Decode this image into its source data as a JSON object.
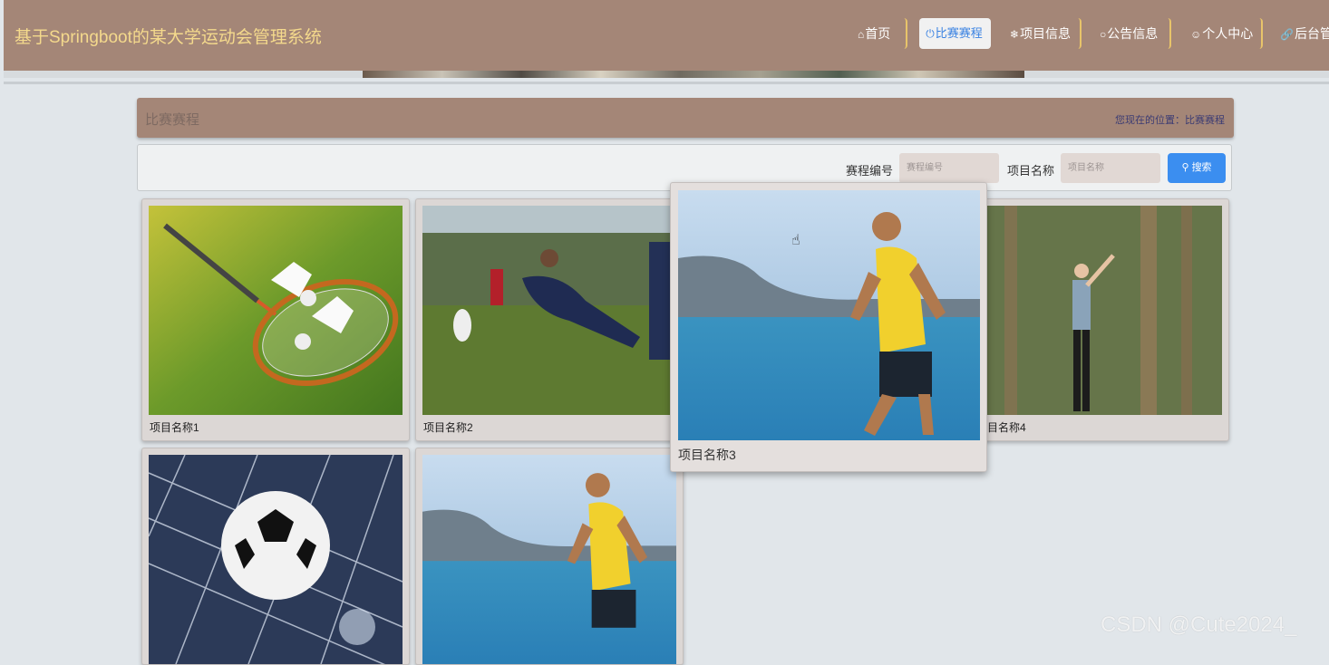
{
  "header": {
    "title": "基于Springboot的某大学运动会管理系统",
    "nav": [
      {
        "icon": "home-icon",
        "glyph": "⌂",
        "label": "首页"
      },
      {
        "icon": "power-icon",
        "glyph": "⏻",
        "label": "比赛赛程",
        "active": true
      },
      {
        "icon": "snowflake-icon",
        "glyph": "❄",
        "label": "项目信息"
      },
      {
        "icon": "circle-icon",
        "glyph": "○",
        "label": "公告信息"
      },
      {
        "icon": "user-icon",
        "glyph": "ꆜ",
        "label": "个人中心"
      },
      {
        "icon": "link-icon",
        "glyph": "🔗",
        "label": "后台管"
      }
    ]
  },
  "page": {
    "title": "比赛赛程",
    "breadcrumb": "您现在的位置：比赛赛程"
  },
  "search": {
    "field1_label": "赛程编号",
    "field1_placeholder": "赛程编号",
    "field2_label": "项目名称",
    "field2_placeholder": "项目名称",
    "button_label": "搜索",
    "button_icon": "search-icon"
  },
  "cards": [
    {
      "name": "项目名称1",
      "image": "badminton"
    },
    {
      "name": "项目名称2",
      "image": "frisbee"
    },
    {
      "name": "项目名称3",
      "image": "runner",
      "hovered": true
    },
    {
      "name": "项目名称4",
      "image": "forest-stretch",
      "visible_label": "目名称4"
    },
    {
      "name": "",
      "image": "soccer"
    },
    {
      "name": "",
      "image": "runner"
    }
  ],
  "watermark": "CSDN @Cute2024_",
  "colors": {
    "header_bg": "#a48677",
    "title_color": "#f4d98c",
    "active_nav_bg": "#f1f1f1",
    "active_nav_text": "#3a82e2",
    "search_button": "#3b8ef0",
    "page_bg": "#e1e6ea"
  }
}
